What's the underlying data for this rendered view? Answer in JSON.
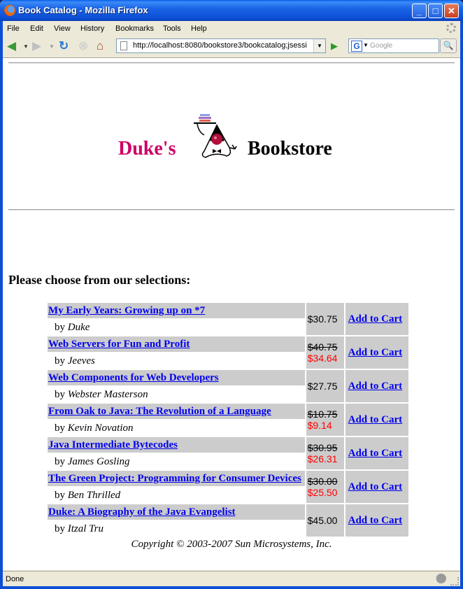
{
  "window": {
    "title": "Book Catalog - Mozilla Firefox",
    "minimize_glyph": "_",
    "maximize_glyph": "□",
    "close_glyph": "✕"
  },
  "menu": [
    "File",
    "Edit",
    "View",
    "History",
    "Bookmarks",
    "Tools",
    "Help"
  ],
  "nav": {
    "back_icon": "◀",
    "forward_icon": "▶",
    "reload_icon": "↻",
    "stop_icon": "⊗",
    "home_icon": "⌂",
    "dropdown_glyph": "▼",
    "url": "http://localhost:8080/bookstore3/bookcatalog;jsessi",
    "go_icon": "▶",
    "search_engine": "G",
    "search_placeholder": "Google",
    "search_icon": "🔍"
  },
  "page": {
    "banner_left": "Duke's",
    "banner_right": "Bookstore",
    "prompt": "Please choose from our selections:",
    "by_label": "by",
    "add_to_cart_label": "Add to Cart",
    "books": [
      {
        "title": "My Early Years: Growing up on *7",
        "author": "Duke",
        "price": "$30.75",
        "sale_price": null
      },
      {
        "title": "Web Servers for Fun and Profit",
        "author": "Jeeves",
        "price": "$40.75",
        "sale_price": "$34.64"
      },
      {
        "title": "Web Components for Web Developers",
        "author": "Webster Masterson",
        "price": "$27.75",
        "sale_price": null
      },
      {
        "title": "From Oak to Java: The Revolution of a Language",
        "author": "Kevin Novation",
        "price": "$10.75",
        "sale_price": "$9.14"
      },
      {
        "title": "Java Intermediate Bytecodes",
        "author": "James Gosling",
        "price": "$30.95",
        "sale_price": "$26.31"
      },
      {
        "title": "The Green Project: Programming for Consumer Devices",
        "author": "Ben Thrilled",
        "price": "$30.00",
        "sale_price": "$25.50"
      },
      {
        "title": "Duke: A Biography of the Java Evangelist",
        "author": "Itzal Tru",
        "price": "$45.00",
        "sale_price": null
      }
    ],
    "copyright": "Copyright © 2003-2007 Sun Microsystems, Inc."
  },
  "status": {
    "text": "Done"
  },
  "colors": {
    "brand_magenta": "#cc0066",
    "link_blue": "#0000ee",
    "sale_red": "#ff0000",
    "cell_gray": "#cccccc"
  }
}
